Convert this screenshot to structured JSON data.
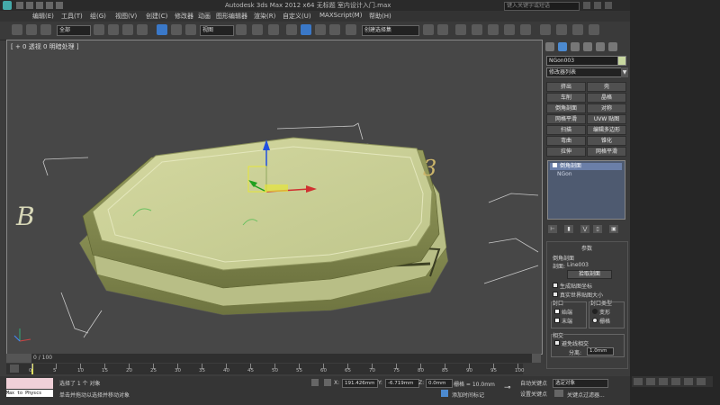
{
  "window": {
    "title": "Autodesk 3ds Max  2012 x64      无标题    室内设计入门.max",
    "search_placeholder": "键入关键字或短语"
  },
  "menu": [
    "编辑(E)",
    "工具(T)",
    "组(G)",
    "视图(V)",
    "创建(C)",
    "修改器",
    "动画",
    "图形编辑器",
    "渲染(R)",
    "自定义(U)",
    "MAXScript(M)",
    "帮助(H)"
  ],
  "toolbar": {
    "selection_filter": "全部",
    "reference_coord": "视图",
    "named_selection": "创建选择集"
  },
  "viewport": {
    "label": "[ + 0 透视 0 明暗处理 ]"
  },
  "command_panel": {
    "object_name": "NGon003",
    "modifier_list": "修改器列表",
    "modifier_buttons": [
      [
        "挤出",
        "壳"
      ],
      [
        "车削",
        "晶格"
      ],
      [
        "倒角剖面",
        "对称"
      ],
      [
        "网格平滑",
        "UVW 贴图"
      ],
      [
        "扫描",
        "编辑多边形"
      ],
      [
        "弯曲",
        "锥化"
      ],
      [
        "拉伸",
        "网格平滑"
      ]
    ],
    "stack": {
      "modifier": "倒角剖面",
      "base": "NGon"
    },
    "params": {
      "rollout_title": "参数",
      "group_bevel_profile": "倒角剖面",
      "profile_label": "剖面:",
      "profile_value": "Line003",
      "pick_profile_button": "拾取剖面",
      "gen_mapping": "生成贴图坐标",
      "real_world": "真实世界贴图大小",
      "cap_group": "封口",
      "cap_start": "始端",
      "cap_end": "末端",
      "cap_type_group": "封口类型",
      "cap_morph": "变形",
      "cap_grid": "栅格",
      "intersect_group": "相交",
      "avoid_lines": "避免线相交",
      "separation_label": "分离:",
      "separation_value": "1.0mm"
    }
  },
  "timeline": {
    "slider_text": "0 / 100",
    "ticks": [
      "0",
      "5",
      "10",
      "15",
      "20",
      "25",
      "30",
      "35",
      "40",
      "45",
      "50",
      "55",
      "60",
      "65",
      "70",
      "75",
      "80",
      "85",
      "90",
      "95",
      "100"
    ]
  },
  "status": {
    "maxscript_text": "Max to Physcs",
    "selected_msg": "选择了 1 个 对象",
    "prompt_msg": "单击并拖动以选择并移动对象",
    "x_label": "X:",
    "x_value": "191.426mm",
    "y_label": "Y:",
    "y_value": "-6.719mm",
    "z_label": "Z:",
    "z_value": "0.0mm",
    "grid_text": "栅格 = 10.0mm",
    "add_time_tag": "添加时间标记",
    "auto_key": "自动关键点",
    "set_key": "设置关键点",
    "key_filter_select": "选定对象",
    "key_filters": "关键点过滤器..."
  },
  "annotations": {
    "b": "B",
    "three": "3"
  }
}
